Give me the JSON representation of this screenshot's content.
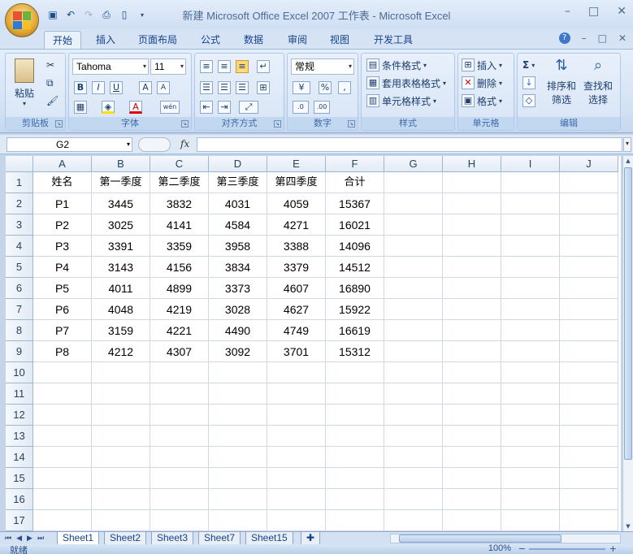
{
  "window": {
    "title": "新建 Microsoft Office Excel 2007 工作表 - Microsoft Excel",
    "minimize": "–",
    "restore": "□",
    "close": "✕"
  },
  "qat": [
    "save-icon",
    "undo-icon",
    "redo-icon",
    "print-preview-icon",
    "new-icon"
  ],
  "ribbon": {
    "tabs": [
      "开始",
      "插入",
      "页面布局",
      "公式",
      "数据",
      "审阅",
      "视图",
      "开发工具"
    ],
    "active_tab": "开始",
    "groups": {
      "clipboard": {
        "label": "剪贴板",
        "paste": "粘贴"
      },
      "font": {
        "label": "字体",
        "font_name": "Tahoma",
        "font_size": "11",
        "bold": "B",
        "italic": "I",
        "underline": "U",
        "grow": "A",
        "shrink": "A",
        "font_color": "A",
        "phonetic": "wén"
      },
      "alignment": {
        "label": "对齐方式"
      },
      "number": {
        "label": "数字",
        "format": "常规",
        "percent": "%",
        "comma": ","
      },
      "styles": {
        "label": "样式",
        "conditional": "条件格式",
        "table": "套用表格格式",
        "cell_styles": "单元格样式"
      },
      "cells": {
        "label": "单元格",
        "insert": "插入",
        "delete": "删除",
        "format": "格式"
      },
      "editing": {
        "label": "编辑",
        "sort": "排序和",
        "sort2": "筛选",
        "find": "查找和",
        "find2": "选择",
        "sum": "Σ"
      }
    }
  },
  "formula_bar": {
    "name_box": "G2",
    "fx": "fx",
    "value": ""
  },
  "sheet": {
    "columns": [
      "A",
      "B",
      "C",
      "D",
      "E",
      "F",
      "G",
      "H",
      "I",
      "J"
    ],
    "rows": [
      "1",
      "2",
      "3",
      "4",
      "5",
      "6",
      "7",
      "8",
      "9",
      "10",
      "11",
      "12",
      "13",
      "14",
      "15",
      "16",
      "17"
    ],
    "header_row": [
      "姓名",
      "第一季度",
      "第二季度",
      "第三季度",
      "第四季度",
      "合计"
    ],
    "data": [
      [
        "P1",
        "3445",
        "3832",
        "4031",
        "4059",
        "15367"
      ],
      [
        "P2",
        "3025",
        "4141",
        "4584",
        "4271",
        "16021"
      ],
      [
        "P3",
        "3391",
        "3359",
        "3958",
        "3388",
        "14096"
      ],
      [
        "P4",
        "3143",
        "4156",
        "3834",
        "3379",
        "14512"
      ],
      [
        "P5",
        "4011",
        "4899",
        "3373",
        "4607",
        "16890"
      ],
      [
        "P6",
        "4048",
        "4219",
        "3028",
        "4627",
        "15922"
      ],
      [
        "P7",
        "3159",
        "4221",
        "4490",
        "4749",
        "16619"
      ],
      [
        "P8",
        "4212",
        "4307",
        "3092",
        "3701",
        "15312"
      ]
    ]
  },
  "sheet_tabs": [
    "Sheet1",
    "Sheet2",
    "Sheet3",
    "Sheet7",
    "Sheet15"
  ],
  "active_sheet": "Sheet1",
  "status": {
    "text": "就绪",
    "zoom": "100%",
    "minus": "−",
    "plus": "+"
  },
  "colors": {
    "ribbon": "#d4e2f4",
    "grid_line": "#d0d7e5",
    "header": "#e1eaf5",
    "title_text": "#4b6a93"
  }
}
